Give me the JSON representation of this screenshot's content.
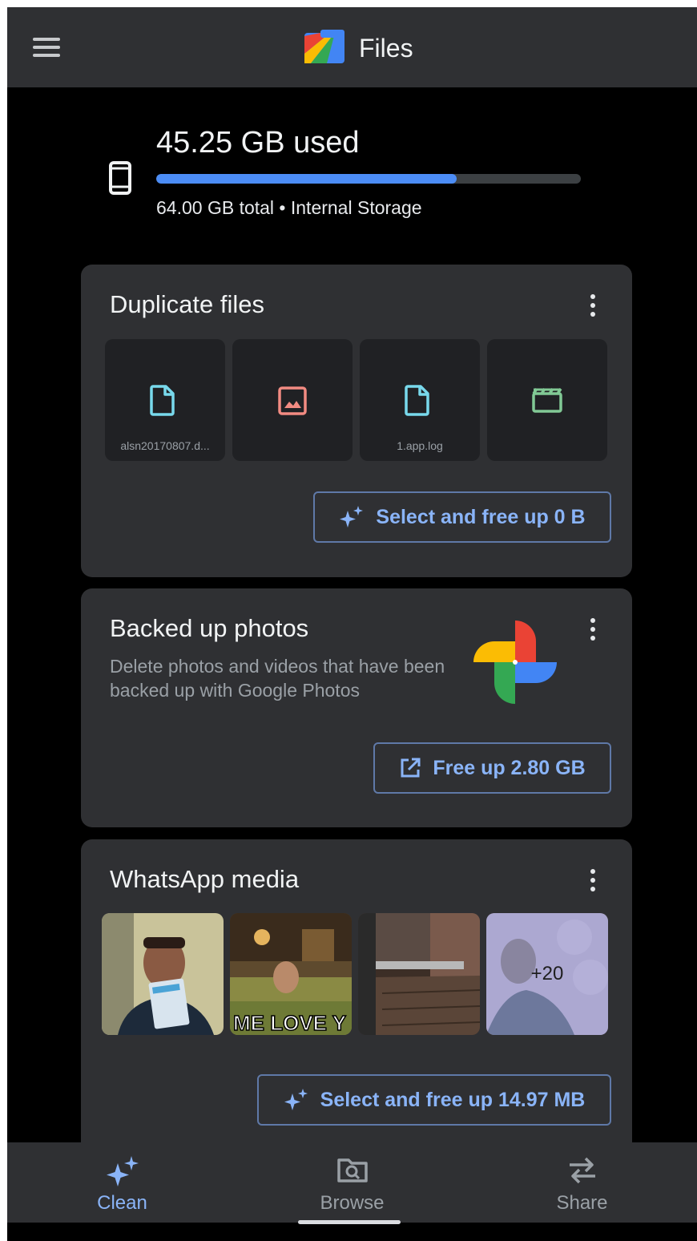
{
  "app": {
    "title": "Files"
  },
  "storage": {
    "used_text": "45.25 GB used",
    "meta_text": "64.00 GB total • Internal Storage",
    "used_fraction": 0.707
  },
  "duplicate_files": {
    "title": "Duplicate files",
    "tiles": [
      {
        "icon": "document-icon",
        "name": "alsn20170807.d..."
      },
      {
        "icon": "image-icon",
        "name": ""
      },
      {
        "icon": "document-icon",
        "name": "1.app.log"
      },
      {
        "icon": "video-icon",
        "name": ""
      }
    ],
    "action_label": "Select and free up 0 B"
  },
  "backed_up_photos": {
    "title": "Backed up photos",
    "description": "Delete photos and videos that have been backed up with Google Photos",
    "action_label": "Free up 2.80 GB"
  },
  "whatsapp_media": {
    "title": "WhatsApp media",
    "more_count": "+20",
    "meme_caption": "ME LOVE Y",
    "action_label": "Select and free up 14.97 MB"
  },
  "bottom_nav": {
    "items": [
      {
        "label": "Clean",
        "icon": "sparkle-icon",
        "active": true
      },
      {
        "label": "Browse",
        "icon": "folder-search-icon",
        "active": false
      },
      {
        "label": "Share",
        "icon": "swap-arrows-icon",
        "active": false
      }
    ]
  },
  "colors": {
    "accent": "#8ab4f8",
    "progress": "#4c8df6",
    "surface": "#2f3033",
    "background": "#000000"
  }
}
